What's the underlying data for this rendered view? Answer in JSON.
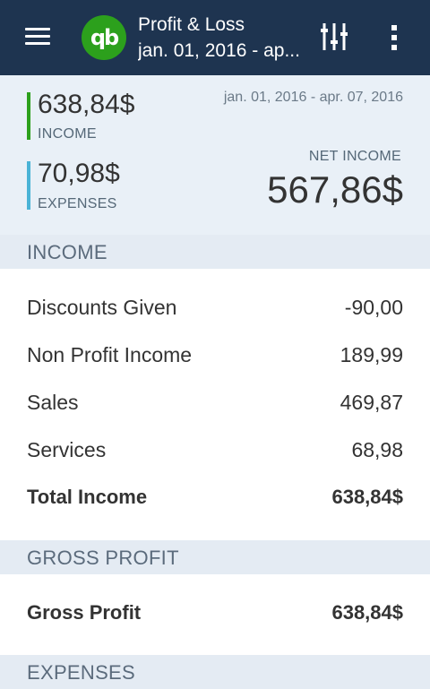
{
  "appbar": {
    "title": "Profit & Loss",
    "subtitle": "jan. 01, 2016 - ap...",
    "logo_text": "qb",
    "icons": {
      "menu": "menu-icon",
      "filter": "filter-icon",
      "more": "more-vert-icon"
    },
    "colors": {
      "background": "#1e3450",
      "logo": "#2ca01c"
    }
  },
  "summary": {
    "income_value": "638,84$",
    "income_label": "INCOME",
    "expenses_value": "70,98$",
    "expenses_label": "EXPENSES",
    "date_range": "jan. 01, 2016 - apr. 07, 2016",
    "net_label": "NET INCOME",
    "net_value": "567,86$",
    "colors": {
      "income_bar": "#2ca01c",
      "expenses_bar": "#4ab3d6"
    }
  },
  "sections": {
    "income": {
      "header": "INCOME",
      "rows": [
        {
          "label": "Discounts Given",
          "value": "-90,00"
        },
        {
          "label": "Non Profit Income",
          "value": "189,99"
        },
        {
          "label": "Sales",
          "value": "469,87"
        },
        {
          "label": "Services",
          "value": "68,98"
        }
      ],
      "total": {
        "label": "Total Income",
        "value": "638,84$"
      }
    },
    "gross_profit": {
      "header": "GROSS PROFIT",
      "total": {
        "label": "Gross Profit",
        "value": "638,84$"
      }
    },
    "expenses": {
      "header": "EXPENSES"
    }
  }
}
